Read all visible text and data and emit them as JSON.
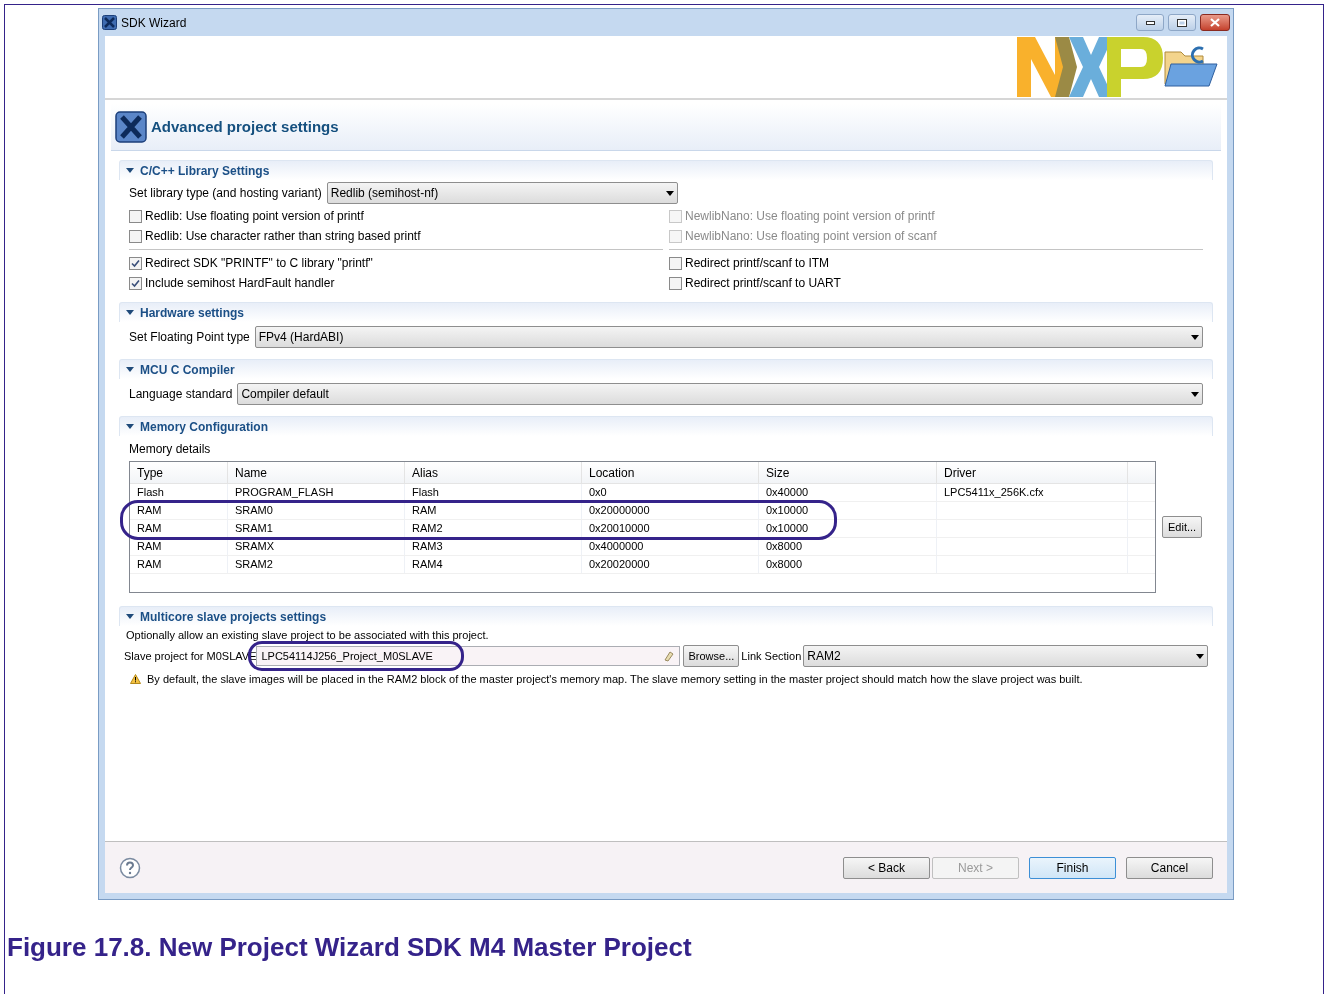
{
  "window": {
    "title": "SDK Wizard"
  },
  "page": {
    "title": "Advanced project settings"
  },
  "sections": [
    {
      "kind": "library",
      "title": "C/C++ Library Settings",
      "expanded": true,
      "library_type": {
        "label": "Set library type (and hosting variant)",
        "value": "Redlib (semihost-nf)"
      },
      "left_options": [
        [
          {
            "label": "Redlib: Use floating point version of printf",
            "checked": false,
            "disabled": false
          },
          {
            "label": "Redlib: Use character rather than string based printf",
            "checked": false,
            "disabled": false
          }
        ],
        [
          {
            "label": "Redirect SDK \"PRINTF\" to C library \"printf\"",
            "checked": true,
            "disabled": false
          },
          {
            "label": "Include semihost HardFault handler",
            "checked": true,
            "disabled": false
          }
        ]
      ],
      "right_options": [
        [
          {
            "label": "NewlibNano: Use floating point version of printf",
            "checked": false,
            "disabled": true
          },
          {
            "label": "NewlibNano: Use floating point version of scanf",
            "checked": false,
            "disabled": true
          }
        ],
        [
          {
            "label": "Redirect printf/scanf to ITM",
            "checked": false,
            "disabled": false
          },
          {
            "label": "Redirect printf/scanf to UART",
            "checked": false,
            "disabled": false
          }
        ]
      ]
    },
    {
      "kind": "select",
      "title": "Hardware settings",
      "expanded": true,
      "label": "Set Floating Point type",
      "value": "FPv4 (HardABI)"
    },
    {
      "kind": "select",
      "title": "MCU C Compiler",
      "expanded": true,
      "label": "Language standard",
      "value": "Compiler default"
    },
    {
      "kind": "memory",
      "title": "Memory Configuration",
      "expanded": true,
      "label": "Memory details",
      "table": {
        "columns": [
          "Type",
          "Name",
          "Alias",
          "Location",
          "Size",
          "Driver"
        ],
        "rows": [
          {
            "cells": [
              "Flash",
              "PROGRAM_FLASH",
              "Flash",
              "0x0",
              "0x40000",
              "LPC5411x_256K.cfx"
            ],
            "circled": false
          },
          {
            "cells": [
              "RAM",
              "SRAM0",
              "RAM",
              "0x20000000",
              "0x10000",
              ""
            ],
            "circled": true
          },
          {
            "cells": [
              "RAM",
              "SRAM1",
              "RAM2",
              "0x20010000",
              "0x10000",
              ""
            ],
            "circled": true
          },
          {
            "cells": [
              "RAM",
              "SRAMX",
              "RAM3",
              "0x4000000",
              "0x8000",
              ""
            ],
            "circled": false
          },
          {
            "cells": [
              "RAM",
              "SRAM2",
              "RAM4",
              "0x20020000",
              "0x8000",
              ""
            ],
            "circled": false
          }
        ]
      },
      "edit_button": "Edit..."
    },
    {
      "kind": "multicore",
      "title": "Multicore slave projects settings",
      "expanded": true,
      "description": "Optionally allow an existing slave project to be associated with this project.",
      "slave_label": "Slave project for M0SLAVE",
      "slave_value": "LPC54114J256_Project_M0SLAVE",
      "slave_circled": true,
      "browse_button": "Browse...",
      "link_label": "Link Section",
      "link_value": "RAM2",
      "note": "By default, the slave images will be placed in the RAM2 block of the master project's memory map. The slave memory setting in the master project should match how the slave project was built."
    }
  ],
  "footer": {
    "buttons": [
      {
        "label": "< Back",
        "disabled": false,
        "default": false
      },
      {
        "label": "Next >",
        "disabled": true,
        "default": false
      },
      {
        "label": "Finish",
        "disabled": false,
        "default": true
      },
      {
        "label": "Cancel",
        "disabled": false,
        "default": false
      }
    ]
  },
  "caption": "Figure 17.8. New Project Wizard SDK M4 Master Project"
}
